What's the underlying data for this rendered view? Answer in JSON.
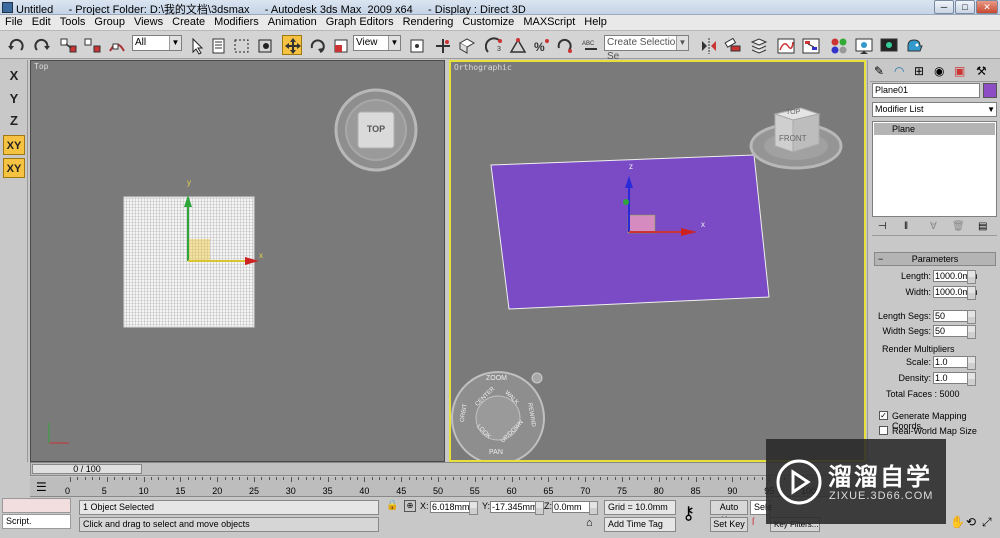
{
  "window": {
    "title": "Untitled     - Project Folder: D:\\我的文档\\3dsmax     - Autodesk 3ds Max  2009 x64     - Display : Direct 3D"
  },
  "menu": [
    "File",
    "Edit",
    "Tools",
    "Group",
    "Views",
    "Create",
    "Modifiers",
    "Animation",
    "Graph Editors",
    "Rendering",
    "Customize",
    "MAXScript",
    "Help"
  ],
  "toolbar": {
    "filter_value": "All",
    "ref_coord_value": "View",
    "selection_set_placeholder": "Create Selection Se"
  },
  "axis_constraints": [
    "X",
    "Y",
    "Z",
    "XY",
    "XY"
  ],
  "viewports": {
    "top": {
      "label": "Top",
      "viewcube_face": "TOP",
      "gizmo_x": "x",
      "gizmo_y": "y"
    },
    "ortho": {
      "label": "Orthographic",
      "viewcube_top": "TOP",
      "viewcube_front": "FRONT",
      "gizmo_x": "x",
      "gizmo_z": "z"
    }
  },
  "steering_wheel": {
    "zoom": "ZOOM",
    "orbit": "ORBIT",
    "center": "CENTER",
    "walk": "WALK",
    "rewind": "REWIND",
    "look": "LOOK",
    "updown": "UP/DOWN",
    "pan": "PAN"
  },
  "command_panel": {
    "object_name": "Plane01",
    "object_color": "#8d4ec5",
    "modifier_list": "Modifier List",
    "stack_item": "Plane",
    "parameters": {
      "title": "Parameters",
      "length_label": "Length:",
      "length": "1000.0mm",
      "width_label": "Width:",
      "width": "1000.0mm",
      "length_segs_label": "Length Segs:",
      "length_segs": "50",
      "width_segs_label": "Width Segs:",
      "width_segs": "50",
      "render_mult_label": "Render Multipliers",
      "scale_label": "Scale:",
      "scale": "1.0",
      "density_label": "Density:",
      "density": "1.0",
      "total_faces": "Total Faces : 5000",
      "gen_mapping": "Generate Mapping Coords.",
      "real_world": "Real-World Map Size"
    }
  },
  "timeline": {
    "slider_text": "0 / 100",
    "ticks": [
      "0",
      "5",
      "10",
      "15",
      "20",
      "25",
      "30",
      "35",
      "40",
      "45",
      "50",
      "55",
      "60",
      "65",
      "70",
      "75",
      "80",
      "85",
      "90",
      "95",
      "100"
    ]
  },
  "status": {
    "maxscript": "Script.",
    "selected": "1 Object Selected",
    "prompt": "Click and drag to select and move objects",
    "x_label": "X:",
    "x": "6.018mm",
    "y_label": "Y:",
    "y": "-17.345mm",
    "z_label": "Z:",
    "z": "0.0mm",
    "grid": "Grid = 10.0mm",
    "add_time_tag": "Add Time Tag",
    "auto_key": "Auto Key",
    "set_key": "Set Key",
    "selected_dropdown": "Sele",
    "key_filters": "Key Filters..."
  },
  "watermark": {
    "brand": "溜溜自学",
    "url": "ZIXUE.3D66.COM"
  },
  "colors": {
    "plane": "#7a4bc4",
    "accent_yellow": "#f5c242",
    "active_border": "#e8e03a"
  }
}
